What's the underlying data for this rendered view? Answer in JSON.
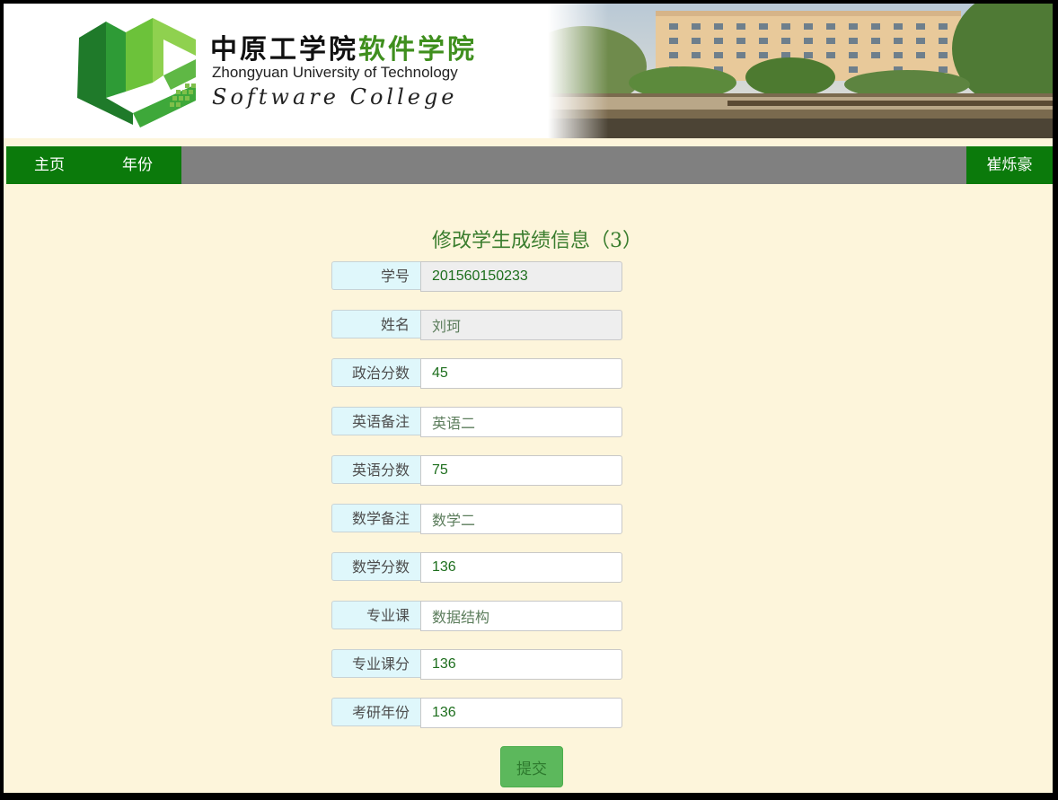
{
  "banner": {
    "cn_title_part1": "中原工学院",
    "cn_title_part2": "软件学院",
    "en_university": "Zhongyuan University of Technology",
    "en_college": "Software College"
  },
  "navbar": {
    "home_label": "主页",
    "year_label": "年份",
    "user_name": "崔烁豪"
  },
  "form": {
    "title": "修改学生成绩信息（3）",
    "fields": [
      {
        "label": "学号",
        "value": "201560150233",
        "readonly": true
      },
      {
        "label": "姓名",
        "value": "刘珂",
        "readonly": true
      },
      {
        "label": "政治分数",
        "value": "45",
        "readonly": false
      },
      {
        "label": "英语备注",
        "value": "英语二",
        "readonly": false
      },
      {
        "label": "英语分数",
        "value": "75",
        "readonly": false
      },
      {
        "label": "数学备注",
        "value": "数学二",
        "readonly": false
      },
      {
        "label": "数学分数",
        "value": "136",
        "readonly": false
      },
      {
        "label": "专业课",
        "value": "数据结构",
        "readonly": false
      },
      {
        "label": "专业课分",
        "value": "136",
        "readonly": false
      },
      {
        "label": "考研年份",
        "value": "136",
        "readonly": false
      }
    ],
    "submit_label": "提交"
  },
  "colors": {
    "nav_green": "#0b7a0b",
    "nav_gray": "#808080",
    "page_bg": "#fdf5db",
    "label_bg": "#dff7fb",
    "value_text": "#1d6e1d",
    "submit_bg": "#5cb85c"
  }
}
